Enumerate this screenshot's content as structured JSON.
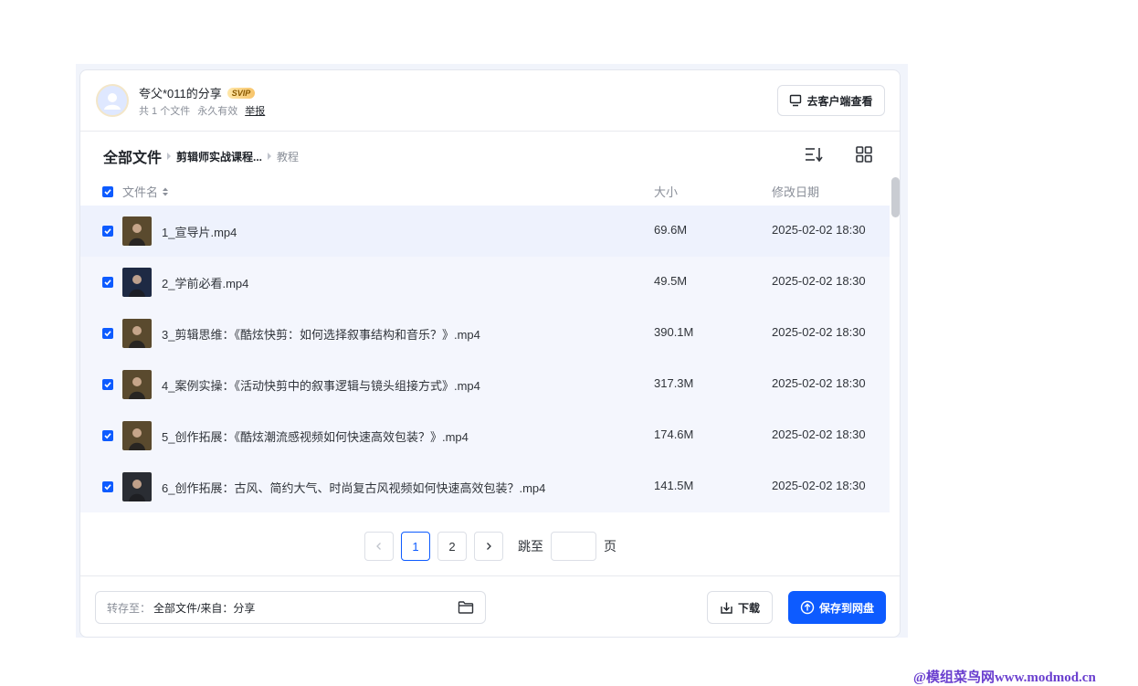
{
  "share": {
    "title": "夸父*011的分享",
    "badge": "SVIP",
    "file_count": "共 1 个文件",
    "validity": "永久有效",
    "report": "举报",
    "client_button": "去客户端查看"
  },
  "breadcrumb": {
    "root": "全部文件",
    "middle": "剪辑师实战课程...",
    "current": "教程"
  },
  "table": {
    "col_name": "文件名",
    "col_size": "大小",
    "col_date": "修改日期",
    "rows": [
      {
        "name": "1_宣导片.mp4",
        "size": "69.6M",
        "date": "2025-02-02 18:30",
        "thumb_color": "#5a4a2e"
      },
      {
        "name": "2_学前必看.mp4",
        "size": "49.5M",
        "date": "2025-02-02 18:30",
        "thumb_color": "#1e2a44"
      },
      {
        "name": "3_剪辑思维：《酷炫快剪：如何选择叙事结构和音乐？》.mp4",
        "size": "390.1M",
        "date": "2025-02-02 18:30",
        "thumb_color": "#5a4a2e"
      },
      {
        "name": "4_案例实操：《活动快剪中的叙事逻辑与镜头组接方式》.mp4",
        "size": "317.3M",
        "date": "2025-02-02 18:30",
        "thumb_color": "#5a4a2e"
      },
      {
        "name": "5_创作拓展：《酷炫潮流感视频如何快速高效包装？》.mp4",
        "size": "174.6M",
        "date": "2025-02-02 18:30",
        "thumb_color": "#5a4a2e"
      },
      {
        "name": "6_创作拓展：古风、简约大气、时尚复古风视频如何快速高效包装？.mp4",
        "size": "141.5M",
        "date": "2025-02-02 18:30",
        "thumb_color": "#2a2d33"
      }
    ]
  },
  "pagination": {
    "pages": [
      "1",
      "2"
    ],
    "current": "1",
    "jump_label": "跳至",
    "page_unit": "页"
  },
  "footer": {
    "save_to_label": "转存至：",
    "save_to_value": "全部文件/来自：分享",
    "download": "下载",
    "save": "保存到网盘"
  },
  "watermark": "@模组菜鸟网www.modmod.cn",
  "colors": {
    "accent": "#0d5bff",
    "row_bg": "#f4f6fd"
  }
}
